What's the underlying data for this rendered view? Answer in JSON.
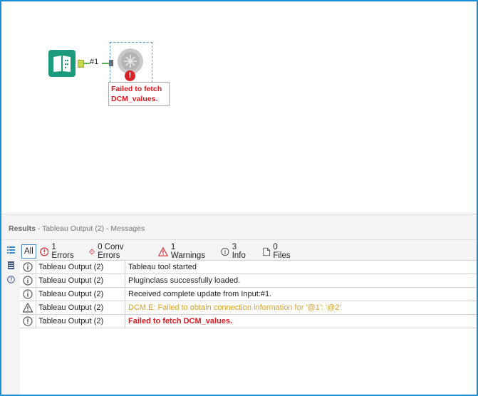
{
  "canvas": {
    "connection_label": "#1",
    "error_callout": [
      "Failed to fetch",
      "DCM_values."
    ]
  },
  "results": {
    "title": "Results",
    "subtitle": " - Tableau Output (2) - Messages",
    "filters": {
      "all": "All",
      "errors": "1 Errors",
      "conv_errors": "0 Conv Errors",
      "warnings": "1 Warnings",
      "info": "3 Info",
      "files": "0 Files"
    },
    "rows": [
      {
        "type": "info",
        "source": "Tableau Output (2)",
        "message": "Tableau tool started"
      },
      {
        "type": "info",
        "source": "Tableau Output (2)",
        "message": "Pluginclass successfully loaded."
      },
      {
        "type": "info",
        "source": "Tableau Output (2)",
        "message": "Received complete update from Input:#1."
      },
      {
        "type": "warning",
        "source": "Tableau Output (2)",
        "message": "DCM.E: Failed to obtain connection information for '@1': '@2'"
      },
      {
        "type": "error",
        "source": "Tableau Output (2)",
        "message": "Failed to fetch DCM_values."
      }
    ]
  },
  "colors": {
    "accent": "#1a8fd6",
    "error": "#e0181e",
    "warning": "#e0a020",
    "input_tool": "#1b9a7c"
  }
}
